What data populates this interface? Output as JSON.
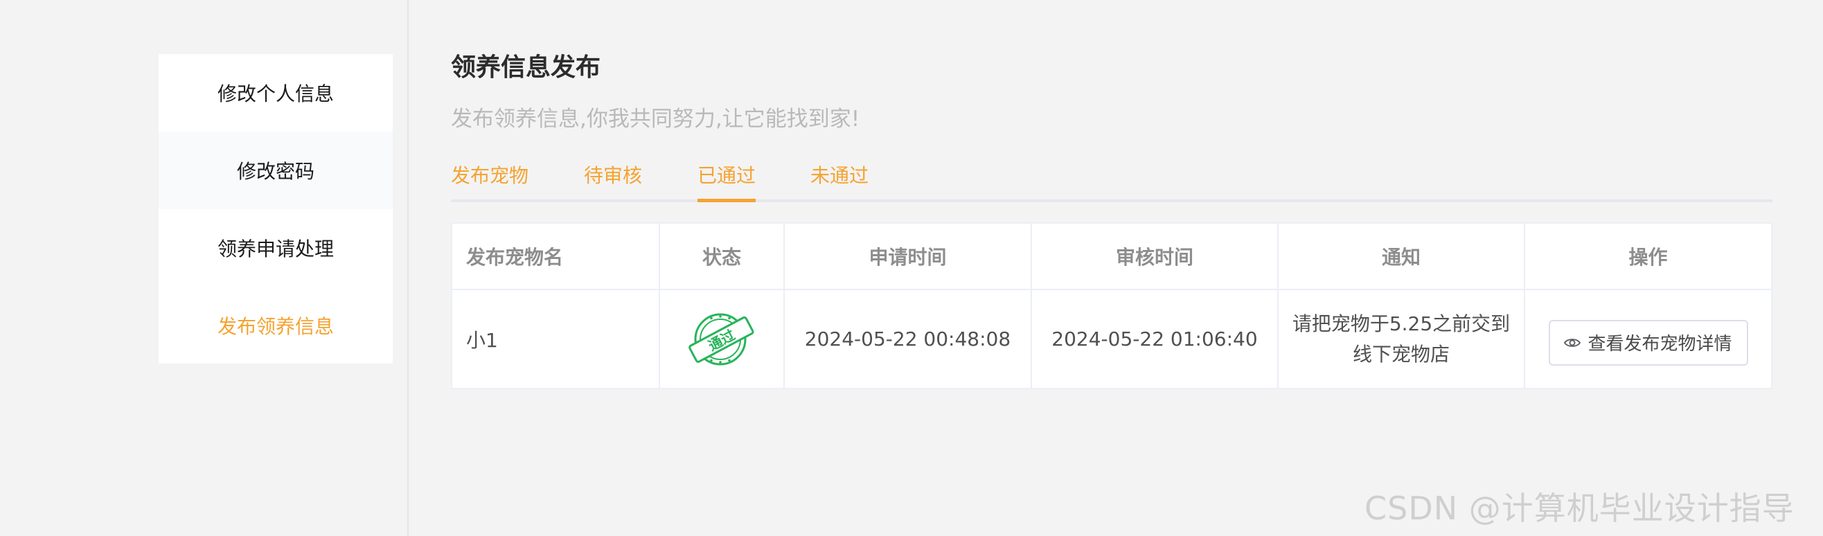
{
  "sidebar": {
    "items": [
      {
        "label": "修改个人信息"
      },
      {
        "label": "修改密码"
      },
      {
        "label": "领养申请处理"
      },
      {
        "label": "发布领养信息"
      }
    ]
  },
  "header": {
    "title": "领养信息发布",
    "subtitle": "发布领养信息,你我共同努力,让它能找到家!"
  },
  "tabs": [
    {
      "label": "发布宠物"
    },
    {
      "label": "待审核"
    },
    {
      "label": "已通过"
    },
    {
      "label": "未通过"
    }
  ],
  "table": {
    "columns": [
      "发布宠物名",
      "状态",
      "申请时间",
      "审核时间",
      "通知",
      "操作"
    ],
    "rows": [
      {
        "pet_name": "小1",
        "status_stamp": "通过",
        "apply_time": "2024-05-22 00:48:08",
        "review_time": "2024-05-22 01:06:40",
        "notice": "请把宠物于5.25之前交到线下宠物店",
        "action_label": "查看发布宠物详情"
      }
    ]
  },
  "colors": {
    "accent": "#f4a331",
    "stamp_green": "#27b45a"
  },
  "icons": {
    "detail_button_icon": "eye-icon",
    "status_stamp": "approved-stamp"
  },
  "watermark": "CSDN @计算机毕业设计指导"
}
